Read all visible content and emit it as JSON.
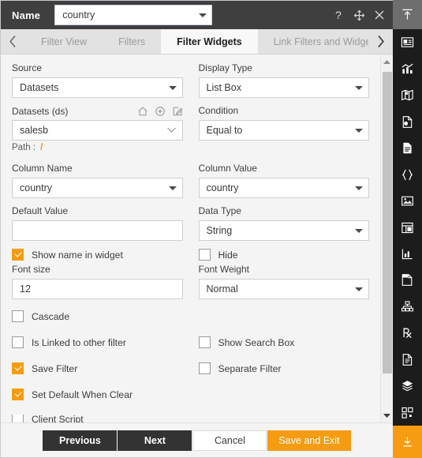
{
  "titlebar": {
    "name_label": "Name",
    "name_value": "country",
    "icons": [
      {
        "name": "help-icon",
        "glyph": "?"
      },
      {
        "name": "move-icon",
        "glyph": "move"
      },
      {
        "name": "close-icon",
        "glyph": "x"
      }
    ]
  },
  "tabs": {
    "prev_arrow": "‹",
    "next_arrow": "›",
    "items": [
      {
        "label": "Filter View",
        "active": false
      },
      {
        "label": "Filters",
        "active": false
      },
      {
        "label": "Filter Widgets",
        "active": true
      },
      {
        "label": "Link Filters and Widgets",
        "active": false
      }
    ]
  },
  "form": {
    "source": {
      "label": "Source",
      "value": "Datasets"
    },
    "display_type": {
      "label": "Display Type",
      "value": "List Box"
    },
    "datasets": {
      "label": "Datasets (ds)",
      "value": "salesb",
      "icons": [
        {
          "name": "home-icon"
        },
        {
          "name": "add-circle-icon"
        },
        {
          "name": "edit-icon"
        }
      ]
    },
    "condition": {
      "label": "Condition",
      "value": "Equal to"
    },
    "path": {
      "label": "Path :",
      "value": "/"
    },
    "column_name": {
      "label": "Column Name",
      "value": "country"
    },
    "column_value": {
      "label": "Column Value",
      "value": "country"
    },
    "default_value": {
      "label": "Default Value",
      "value": "",
      "placeholder": ""
    },
    "data_type": {
      "label": "Data Type",
      "value": "String"
    },
    "show_name_in_widget": {
      "label": "Show name in widget",
      "checked": true
    },
    "hide": {
      "label": "Hide",
      "checked": false
    },
    "font_size": {
      "label": "Font size",
      "value": "12"
    },
    "font_weight": {
      "label": "Font Weight",
      "value": "Normal"
    },
    "cascade": {
      "label": "Cascade",
      "checked": false
    },
    "is_linked": {
      "label": "Is Linked to other filter",
      "checked": false
    },
    "show_search_box": {
      "label": "Show Search Box",
      "checked": false
    },
    "save_filter": {
      "label": "Save Filter",
      "checked": true
    },
    "separate_filter": {
      "label": "Separate Filter",
      "checked": false
    },
    "set_default_when_clear": {
      "label": "Set Default When Clear",
      "checked": true
    },
    "client_script": {
      "label": "Client Script",
      "checked": false
    }
  },
  "footer": {
    "previous": "Previous",
    "next": "Next",
    "cancel": "Cancel",
    "save_and_exit": "Save and Exit"
  },
  "rail": {
    "top": {
      "name": "collapse-panel-icon"
    },
    "items": [
      {
        "name": "dashboard-icon"
      },
      {
        "name": "chart-icon"
      },
      {
        "name": "map-icon"
      },
      {
        "name": "report-page-icon"
      },
      {
        "name": "document-icon"
      },
      {
        "name": "code-braces-icon"
      },
      {
        "name": "image-icon"
      },
      {
        "name": "table-widget-icon"
      },
      {
        "name": "bar-small-icon"
      },
      {
        "name": "copy-page-icon"
      },
      {
        "name": "hierarchy-icon"
      },
      {
        "name": "prescription-icon"
      },
      {
        "name": "script-doc-icon"
      },
      {
        "name": "layers-icon"
      },
      {
        "name": "grid-apps-icon"
      }
    ],
    "bottom": {
      "name": "download-icon"
    }
  },
  "colors": {
    "accent": "#f59c12",
    "titlebar": "#3f3f3f",
    "rail": "#1c1c1c",
    "tab_active_bg": "#f8f8f8"
  }
}
